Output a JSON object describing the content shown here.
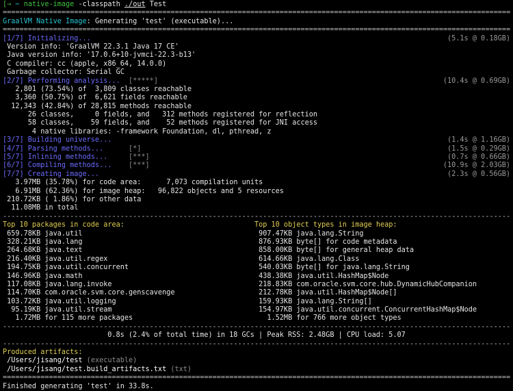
{
  "prompt": {
    "arrow": "[→",
    "tilde": "~",
    "command": "native-image",
    "args_a": " -classpath ",
    "path": "./out",
    "args_b": " Test"
  },
  "separator": "============================================================================================================================",
  "dash_separator": "----------------------------------------------------------------------------------------------------------------------------",
  "header": {
    "product": "GraalVM Native Image",
    "rest": ": Generating 'test' (executable)..."
  },
  "init": {
    "step": "[1/7] Initializing...",
    "timing": "(5.1s @ 0.18GB)",
    "lines": [
      " Version info: 'GraalVM 22.3.1 Java 17 CE'",
      " Java version info: '17.0.6+10-jvmci-22.3-b13'",
      " C compiler: cc (apple, x86_64, 14.0.0)",
      " Garbage collector: Serial GC"
    ]
  },
  "analysis": {
    "step": "[2/7] Performing analysis...",
    "bar": "  [*****]",
    "timing": "(10.4s @ 0.69GB)",
    "lines": [
      "   2,801 (73.54%) of  3,809 classes reachable",
      "   3,360 (50.75%) of  6,621 fields reachable",
      "  12,343 (42.84%) of 28,815 methods reachable",
      "      26 classes,     0 fields, and   312 methods registered for reflection",
      "      58 classes,    59 fields, and    52 methods registered for JNI access",
      "       4 native libraries: -framework Foundation, dl, pthread, z"
    ]
  },
  "steps": [
    {
      "label": "[3/7] Building universe...",
      "bar": "",
      "timing": "(1.4s @ 1.16GB)"
    },
    {
      "label": "[4/7] Parsing methods...",
      "bar": "      [*]",
      "timing": "(1.5s @ 0.29GB)"
    },
    {
      "label": "[5/7] Inlining methods...",
      "bar": "     [***]",
      "timing": "(0.7s @ 0.66GB)"
    },
    {
      "label": "[6/7] Compiling methods...",
      "bar": "    [***]",
      "timing": "(10.9s @ 2.03GB)"
    },
    {
      "label": "[7/7] Creating image...",
      "bar": "",
      "timing": "(2.3s @ 0.56GB)"
    }
  ],
  "image_lines": [
    "   3.97MB (35.78%) for code area:      7,073 compilation units",
    "   6.91MB (62.36%) for image heap:   96,822 objects and 5 resources",
    " 210.72KB ( 1.86%) for other data",
    "  11.08MB in total"
  ],
  "packages": {
    "title": "Top 10 packages in code area:",
    "rows": [
      " 659.78KB java.util",
      " 328.21KB java.lang",
      " 264.68KB java.text",
      " 216.40KB java.util.regex",
      " 194.75KB java.util.concurrent",
      " 146.96KB java.math",
      " 117.08KB java.lang.invoke",
      " 114.70KB com.oracle.svm.core.genscavenge",
      " 103.72KB java.util.logging",
      "  95.19KB java.util.stream",
      "   1.72MB for 115 more packages"
    ]
  },
  "object_types": {
    "title": "Top 10 object types in image heap:",
    "rows": [
      " 907.47KB java.lang.String",
      " 876.93KB byte[] for code metadata",
      " 858.00KB byte[] for general heap data",
      " 614.66KB java.lang.Class",
      " 540.03KB byte[] for java.lang.String",
      " 438.38KB java.util.HashMap$Node",
      " 218.83KB com.oracle.svm.core.hub.DynamicHubCompanion",
      " 212.78KB java.util.HashMap$Node[]",
      " 159.93KB java.lang.String[]",
      " 154.97KB java.util.concurrent.ConcurrentHashMap$Node",
      "   1.52MB for 766 more object types"
    ]
  },
  "gc_summary": "0.8s (2.4% of total time) in 18 GCs | Peak RSS: 2.48GB | CPU load: 5.07",
  "artifacts": {
    "title": "Produced artifacts:",
    "items": [
      {
        "path": " /Users/jisang/test",
        "kind": " (executable)"
      },
      {
        "path": " /Users/jisang/test.build_artifacts.txt",
        "kind": " (txt)"
      }
    ]
  },
  "finished": "Finished generating 'test' in 33.8s."
}
